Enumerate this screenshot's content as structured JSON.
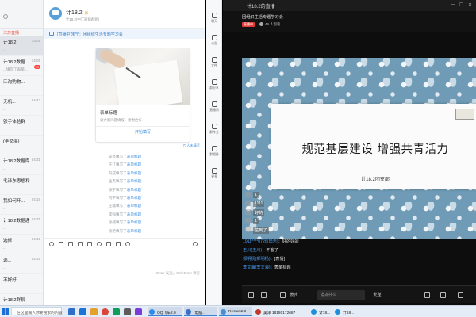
{
  "chat_list": {
    "group_label": "江苏直播",
    "items": [
      {
        "name": "计18.2",
        "time": "14:01",
        "msg": "...",
        "badge": "",
        "active": true
      },
      {
        "name": "计18.2数据...",
        "time": "14:05",
        "msg": "...填写了表单...",
        "badge": "99",
        "active": false
      },
      {
        "name": "江淘购物...",
        "time": "",
        "msg": "...",
        "badge": "",
        "active": false
      },
      {
        "name": "无机...",
        "time": "04:42",
        "msg": "...",
        "badge": "",
        "active": false
      },
      {
        "name": "张手体验群",
        "time": "",
        "msg": "",
        "badge": "",
        "active": false
      },
      {
        "name": "(李文海)",
        "time": "",
        "msg": "",
        "badge": "",
        "active": false
      },
      {
        "name": "计18.2数据库...",
        "time": "04:31",
        "msg": "...",
        "badge": "",
        "active": false
      },
      {
        "name": "毛泽东思想和...",
        "time": "",
        "msg": "...",
        "badge": "",
        "active": false
      },
      {
        "name": "我如何开...",
        "time": "04:15",
        "msg": "...",
        "badge": "",
        "active": false
      },
      {
        "name": "计18.2数据通信",
        "time": "04:31",
        "msg": "...",
        "badge": "",
        "active": false
      },
      {
        "name": "选修",
        "time": "04:15",
        "msg": "...",
        "badge": "",
        "active": false
      },
      {
        "name": "选...",
        "time": "04:15",
        "msg": "...",
        "badge": "",
        "active": false
      },
      {
        "name": "不好好...",
        "time": "",
        "msg": "...",
        "badge": "",
        "active": false
      },
      {
        "name": "计18.2群聊",
        "time": "",
        "msg": "...",
        "badge": "",
        "active": false
      }
    ]
  },
  "chat": {
    "title": "计18.2",
    "tag": "群",
    "subtitle": "计18.2(中江班级群组)",
    "notice": "[直播中]宋宁：团组织生活专题学习会",
    "card": {
      "title": "表单标题",
      "desc": "请大家问题填报，谢谢合作",
      "link": "开始填写"
    },
    "card_meta": "71人未填写",
    "system_messages": [
      {
        "who": "吴亮填写了",
        "what": "表单标题"
      },
      {
        "who": "任江填写了",
        "what": "表单标题"
      },
      {
        "who": "刘成填写了",
        "what": "表单标题"
      },
      {
        "who": "孟杰填写了",
        "what": "表单标题"
      },
      {
        "who": "张宇填写了",
        "what": "表单标题"
      },
      {
        "who": "何平填写了",
        "what": "表单标题"
      },
      {
        "who": "王磊填写了",
        "what": "表单标题"
      },
      {
        "who": "李强填写了",
        "what": "表单标题"
      },
      {
        "who": "张楠填写了",
        "what": "表单标题"
      },
      {
        "who": "张艳填写了",
        "what": "表单标题"
      }
    ],
    "send_hint": "Enter 发送，Ctrl+Enter 换行"
  },
  "chat_side": [
    {
      "label": "聊天",
      "icon": "chat-icon"
    },
    {
      "label": "公告",
      "icon": "notice-icon"
    },
    {
      "label": "文件",
      "icon": "file-icon"
    },
    {
      "label": "群分享",
      "icon": "share-icon"
    },
    {
      "label": "直播间",
      "icon": "live-icon"
    },
    {
      "label": "群作业",
      "icon": "homework-icon"
    },
    {
      "label": "群相册",
      "icon": "album-icon"
    },
    {
      "label": "更多",
      "icon": "more-icon"
    }
  ],
  "live": {
    "window_title": "计18.2的直播",
    "stream_name": "团组织生活专题学习会",
    "badge": "直播中",
    "viewers": "49 人观看",
    "slide_title": "规范基层建设 增强共青活力",
    "slide_org": "计18.2团支部",
    "danmaku": [
      "1",
      "1111",
      "好的",
      "1",
      "签到了"
    ],
    "comments": [
      {
        "user": "1911****0726(田浩)",
        "text": "：好的好的"
      },
      {
        "user": "王川(王川)",
        "text": "：不客了"
      },
      {
        "user": "郑明杨(郑明杨)",
        "text": "：[表情]"
      },
      {
        "user": "李文海(李文海)",
        "text": "：表单标题"
      }
    ],
    "bottom": {
      "mode": "模式",
      "placeholder": "说点什么...",
      "send": "发送"
    }
  },
  "taskbar": {
    "search_text": "在这里输入你要搜索的内容",
    "tasks": [
      {
        "label": "QQ飞车2.0",
        "color": "#2d8ce6"
      },
      {
        "label": "[电脑...",
        "color": "#3a6fc2"
      },
      {
        "label": "Restart2.0",
        "color": "#4a8ed6"
      },
      {
        "label": "吴泽 18180172687",
        "color": "#c0392b"
      },
      {
        "label": "计18...",
        "color": "#1e8fd8"
      },
      {
        "label": "计18...",
        "color": "#1e8fd8"
      }
    ]
  }
}
